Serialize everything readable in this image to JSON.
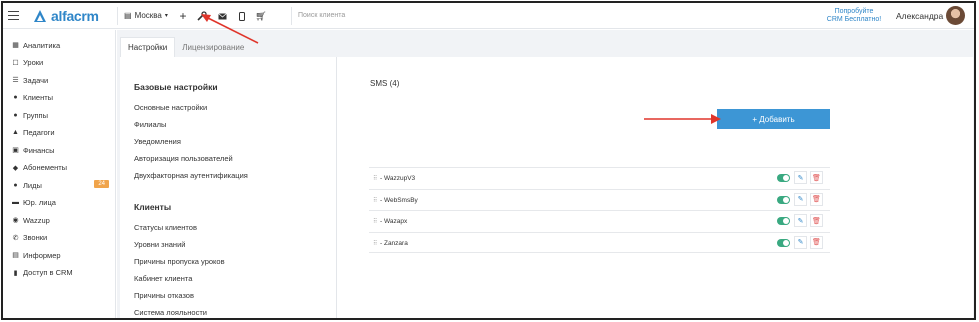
{
  "app": {
    "logo_text": "alfacrm",
    "brand_color": "#2f86c8"
  },
  "topbar": {
    "branch": "Москва",
    "search_placeholder": "Поиск клиента",
    "promo_line1": "Попробуйте",
    "promo_line2": "CRM Бесплатно!",
    "user_name": "Александра"
  },
  "sidebar": {
    "items": [
      {
        "label": "Аналитика",
        "icon": "analytics-icon",
        "glyph": "▦"
      },
      {
        "label": "Уроки",
        "icon": "lessons-icon",
        "glyph": "☐"
      },
      {
        "label": "Задачи",
        "icon": "tasks-icon",
        "glyph": "☰"
      },
      {
        "label": "Клиенты",
        "icon": "clients-icon",
        "glyph": "●"
      },
      {
        "label": "Группы",
        "icon": "groups-icon",
        "glyph": "●"
      },
      {
        "label": "Педагоги",
        "icon": "teachers-icon",
        "glyph": "▲"
      },
      {
        "label": "Финансы",
        "icon": "finance-icon",
        "glyph": "▣"
      },
      {
        "label": "Абонементы",
        "icon": "subscriptions-icon",
        "glyph": "◆"
      },
      {
        "label": "Лиды",
        "icon": "leads-icon",
        "glyph": "●",
        "badge": "24"
      },
      {
        "label": "Юр. лица",
        "icon": "legal-entities-icon",
        "glyph": "▬"
      },
      {
        "label": "Wazzup",
        "icon": "wazzup-icon",
        "glyph": "◉"
      },
      {
        "label": "Звонки",
        "icon": "phone-icon",
        "glyph": "✆"
      },
      {
        "label": "Информер",
        "icon": "informer-icon",
        "glyph": "▤"
      },
      {
        "label": "Доступ в CRM",
        "icon": "lock-icon",
        "glyph": "▮"
      }
    ],
    "badge_color": "#f0a44b"
  },
  "tabs": [
    "Настройки",
    "Лицензирование"
  ],
  "settings": {
    "base_title": "Базовые настройки",
    "base_links": [
      "Основные настройки",
      "Филиалы",
      "Уведомления",
      "Авторизация пользователей",
      "Двухфакторная аутентификация"
    ],
    "clients_title": "Клиенты",
    "clients_links": [
      "Статусы клиентов",
      "Уровни знаний",
      "Причины пропуска уроков",
      "Кабинет клиента",
      "Причины отказов",
      "Система лояльности"
    ]
  },
  "sms": {
    "title": "SMS",
    "count": "(4)",
    "add_button": "+ Добавить",
    "providers": [
      "- WazzupV3",
      "- WebSmsBy",
      "- Wazapx",
      "- Zanzara"
    ],
    "toggle_color": "#3aa981",
    "button_color": "#3d96d5"
  },
  "annotation_color": "#e0352b"
}
